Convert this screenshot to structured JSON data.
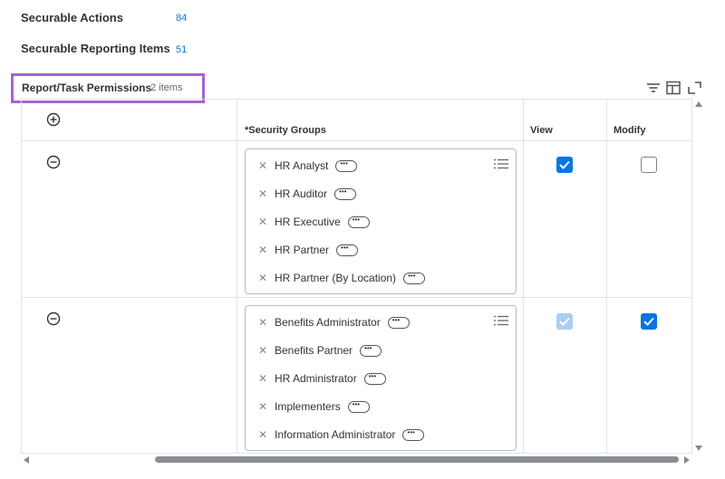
{
  "summary": {
    "actions_label": "Securable Actions",
    "actions_count": "84",
    "reporting_label": "Securable Reporting Items",
    "reporting_count": "51"
  },
  "grid": {
    "title": "Report/Task Permissions",
    "item_count": "2 items",
    "columns": [
      "*Security Groups",
      "View",
      "Modify"
    ],
    "rows": [
      {
        "groups": [
          "HR Analyst",
          "HR Auditor",
          "HR Executive",
          "HR Partner",
          "HR Partner (By Location)"
        ],
        "view": "checked",
        "modify": "unchecked"
      },
      {
        "groups": [
          "Benefits Administrator",
          "Benefits Partner",
          "HR Administrator",
          "Implementers",
          "Information Administrator"
        ],
        "view": "checked-disabled",
        "modify": "checked"
      }
    ]
  },
  "colors": {
    "accent": "#0875e1",
    "highlight": "#a266d6"
  },
  "icons": [
    "add-row-icon",
    "remove-row-icon",
    "filter-icon",
    "column-layout-icon",
    "fullscreen-icon",
    "list-icon",
    "remove-chip-icon",
    "related-actions-icon"
  ]
}
